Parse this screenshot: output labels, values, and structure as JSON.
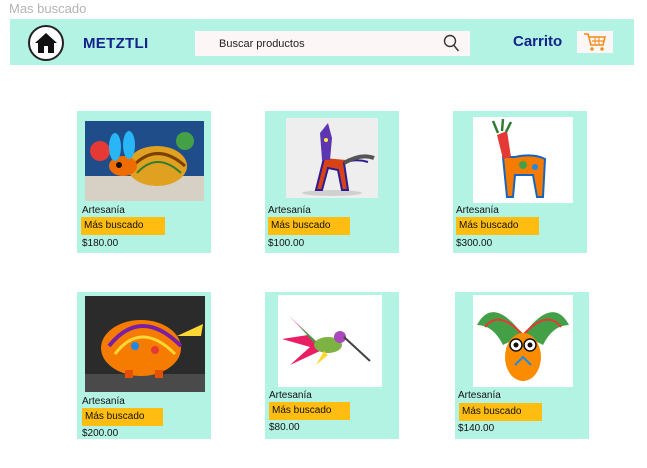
{
  "frame_title": "Mas buscado",
  "header": {
    "brand": "METZTLI",
    "search_placeholder": "Buscar productos",
    "cart_label": "Carrito"
  },
  "products": [
    {
      "category": "Artesanía",
      "badge": "Más buscado",
      "price": "$180.00",
      "image": "alebrije-armadillo-icon"
    },
    {
      "category": "Artesanía",
      "badge": "Más buscado",
      "price": "$100.00",
      "image": "alebrije-coyote-icon"
    },
    {
      "category": "Artesanía",
      "badge": "Más buscado",
      "price": "$300.00",
      "image": "alebrije-deer-icon"
    },
    {
      "category": "Artesanía",
      "badge": "Más buscado",
      "price": "$200.00",
      "image": "alebrije-armadillo-orange-icon"
    },
    {
      "category": "Artesanía",
      "badge": "Más buscado",
      "price": "$80.00",
      "image": "alebrije-hummingbird-icon"
    },
    {
      "category": "Artesanía",
      "badge": "Más buscado",
      "price": "$140.00",
      "image": "alebrije-owl-icon"
    }
  ]
}
